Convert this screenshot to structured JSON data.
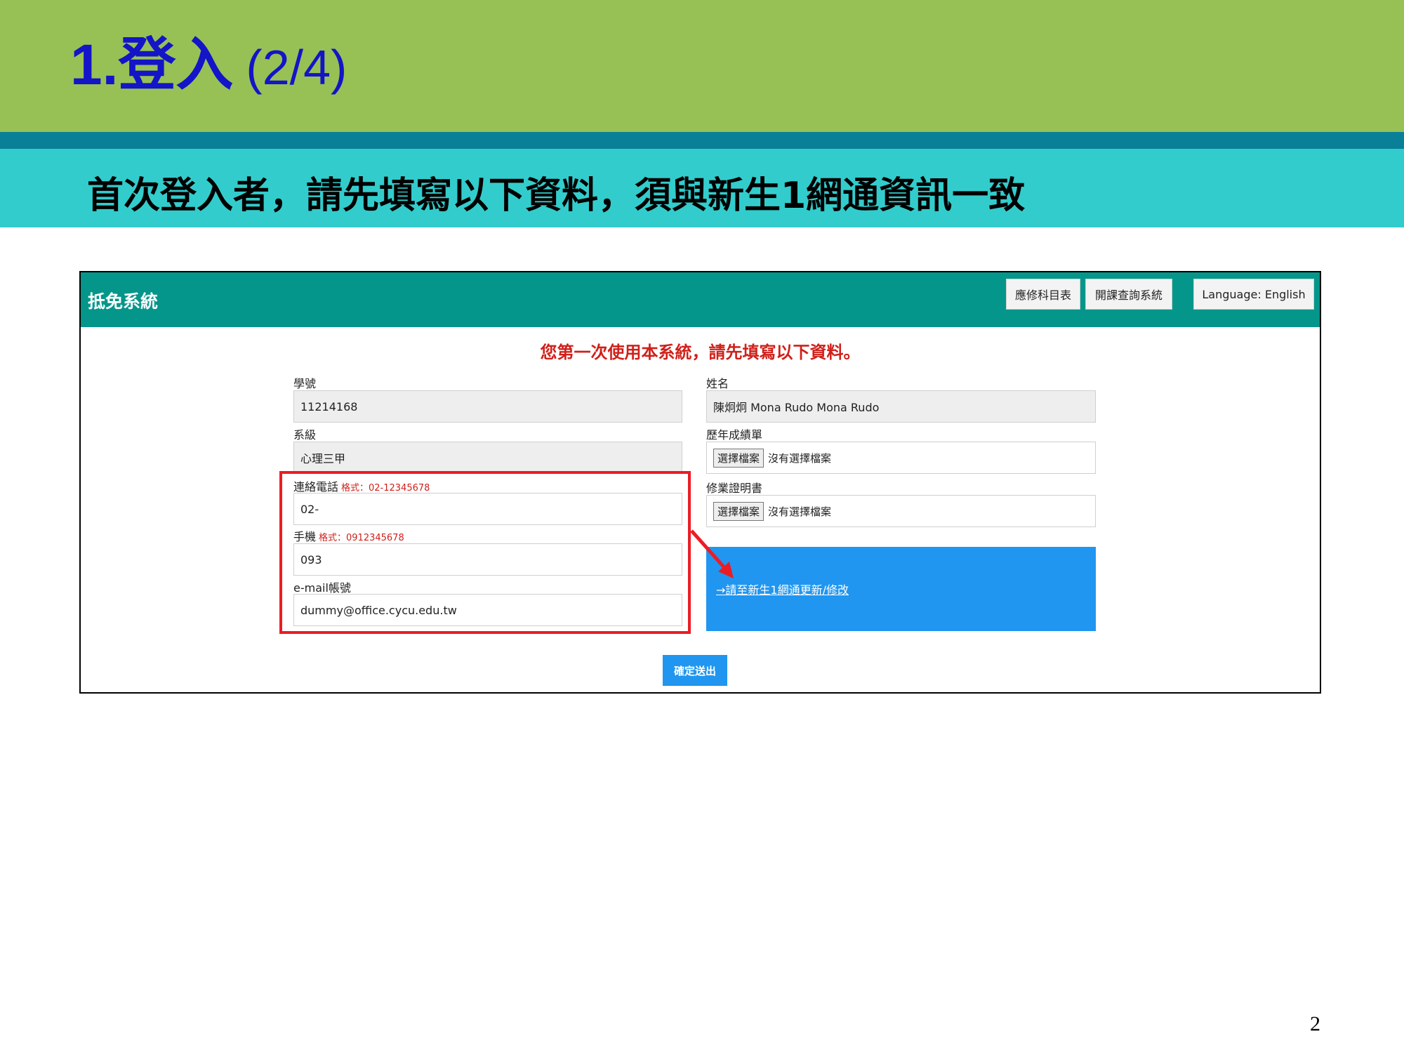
{
  "slide": {
    "title_main": "1.登入",
    "title_suffix": "(2/4)",
    "subtitle": "首次登入者，請先填寫以下資料，須與新生1網通資訊一致",
    "page_number": "2"
  },
  "app": {
    "title": "抵免系統",
    "header_buttons": {
      "required_courses": "應修科目表",
      "course_query": "開課查詢系統",
      "language": "Language: English"
    },
    "form_heading": "您第一次使用本系統，請先填寫以下資料。",
    "fields": {
      "student_id": {
        "label": "學號",
        "value": "11214168"
      },
      "name": {
        "label": "姓名",
        "value": "陳炯炯 Mona Rudo Mona Rudo"
      },
      "department": {
        "label": "系級",
        "value": "心理三甲"
      },
      "transcript": {
        "label": "歷年成績單",
        "button": "選擇檔案",
        "status": "沒有選擇檔案"
      },
      "phone": {
        "label": "連絡電話",
        "hint": "格式：02-12345678",
        "value": "02-"
      },
      "certificate": {
        "label": "修業證明書",
        "button": "選擇檔案",
        "status": "沒有選擇檔案"
      },
      "mobile": {
        "label": "手機",
        "hint": "格式：0912345678",
        "value": "093"
      },
      "email": {
        "label": "e-mail帳號",
        "value": "dummy@office.cycu.edu.tw"
      }
    },
    "update_link": "→請至新生1網通更新/修改",
    "submit": "確定送出"
  },
  "colors": {
    "title_band": "#97c155",
    "title_text": "#1414c8",
    "rule": "#0a7f98",
    "subtitle_band": "#33cccc",
    "app_header": "#04968a",
    "accent_red": "#ec1c24",
    "accent_blue": "#2096f0"
  }
}
